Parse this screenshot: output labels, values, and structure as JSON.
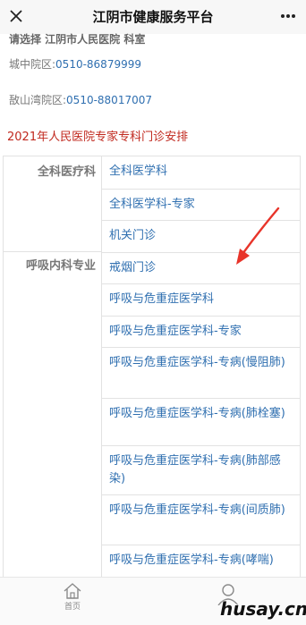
{
  "header": {
    "title": "江阴市健康服务平台",
    "close_icon": "close-icon",
    "more_icon": "more-icon"
  },
  "info": {
    "subheader": "请选择 江阴市人民医院 科室",
    "campuses": [
      {
        "label": "城中院区:",
        "phone": "0510-86879999"
      },
      {
        "label": "敔山湾院区:",
        "phone": "0510-88017007"
      }
    ],
    "section_title": "2021年人民医院专家专科门诊安排"
  },
  "departments": [
    {
      "name": "全科医疗科",
      "clinics": [
        "全科医学科",
        "全科医学科-专家",
        "机关门诊"
      ]
    },
    {
      "name": "呼吸内科专业",
      "clinics": [
        "戒烟门诊",
        "呼吸与危重症医学科",
        "呼吸与危重症医学科-专家",
        "呼吸与危重症医学科-专病(慢阻肺)",
        "呼吸与危重症医学科-专病(肺栓塞)",
        "呼吸与危重症医学科-专病(肺部感染)",
        "呼吸与危重症医学科-专病(间质肺)",
        "呼吸与危重症医学科-专病(哮喘)"
      ]
    }
  ],
  "bottom_nav": {
    "home_label": "首页",
    "home_icon": "home-icon",
    "user_icon": "user-icon"
  },
  "watermark": "husay.cn",
  "colors": {
    "link": "#2f6fb0",
    "section_title": "#c0281e",
    "annotation_arrow": "#e8342a",
    "text_muted": "#777777"
  }
}
